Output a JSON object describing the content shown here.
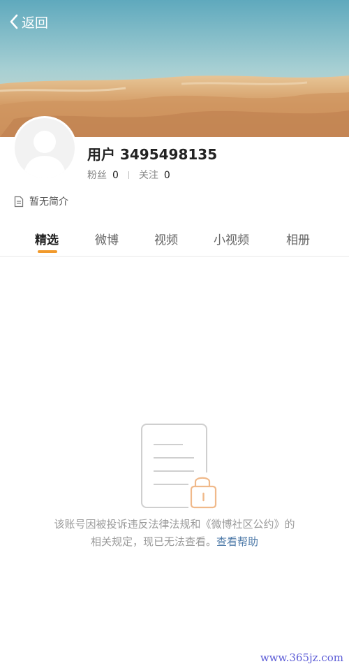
{
  "nav": {
    "back_label": "返回"
  },
  "profile": {
    "username": "用户 3495498135",
    "fans_label": "粉丝",
    "fans_count": "0",
    "following_label": "关注",
    "following_count": "0",
    "bio": "暂无简介"
  },
  "tabs": [
    {
      "label": "精选",
      "active": true
    },
    {
      "label": "微博",
      "active": false
    },
    {
      "label": "视频",
      "active": false
    },
    {
      "label": "小视频",
      "active": false
    },
    {
      "label": "相册",
      "active": false
    }
  ],
  "notice": {
    "text_line1": "该账号因被投诉违反法律法规和《微博社区公约》的",
    "text_line2": "相关规定，现已无法查看。",
    "link": "查看帮助"
  },
  "watermark": "www.365jz.com",
  "colors": {
    "accent": "#f19a2c",
    "link": "#4e7aa8",
    "muted": "#9a9a9a"
  },
  "icons": {
    "back": "chevron-left-icon",
    "bio": "document-icon",
    "lock": "lock-icon"
  }
}
